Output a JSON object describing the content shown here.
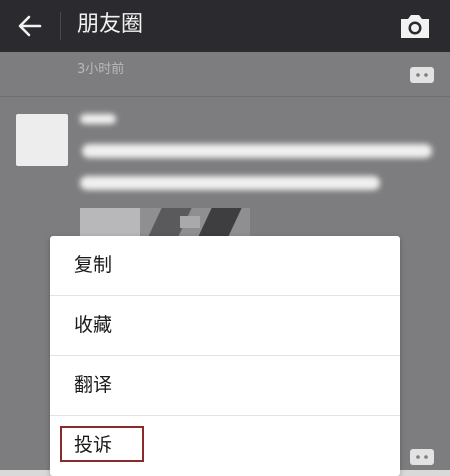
{
  "header": {
    "title": "朋友圈",
    "back_icon": "arrow-left-icon",
    "camera_icon": "camera-icon"
  },
  "feed": {
    "previous_post_time": "3小时前",
    "comment_icon": "comment-bubble-icon"
  },
  "context_menu": {
    "items": [
      {
        "label": "复制"
      },
      {
        "label": "收藏"
      },
      {
        "label": "翻译"
      },
      {
        "label": "投诉"
      }
    ],
    "highlighted_item": "投诉",
    "highlight_color": "#8b2a2a"
  },
  "colors": {
    "topbar": "#2b2b2f",
    "overlay": "#7d7d7f",
    "menu_bg": "#ffffff"
  }
}
